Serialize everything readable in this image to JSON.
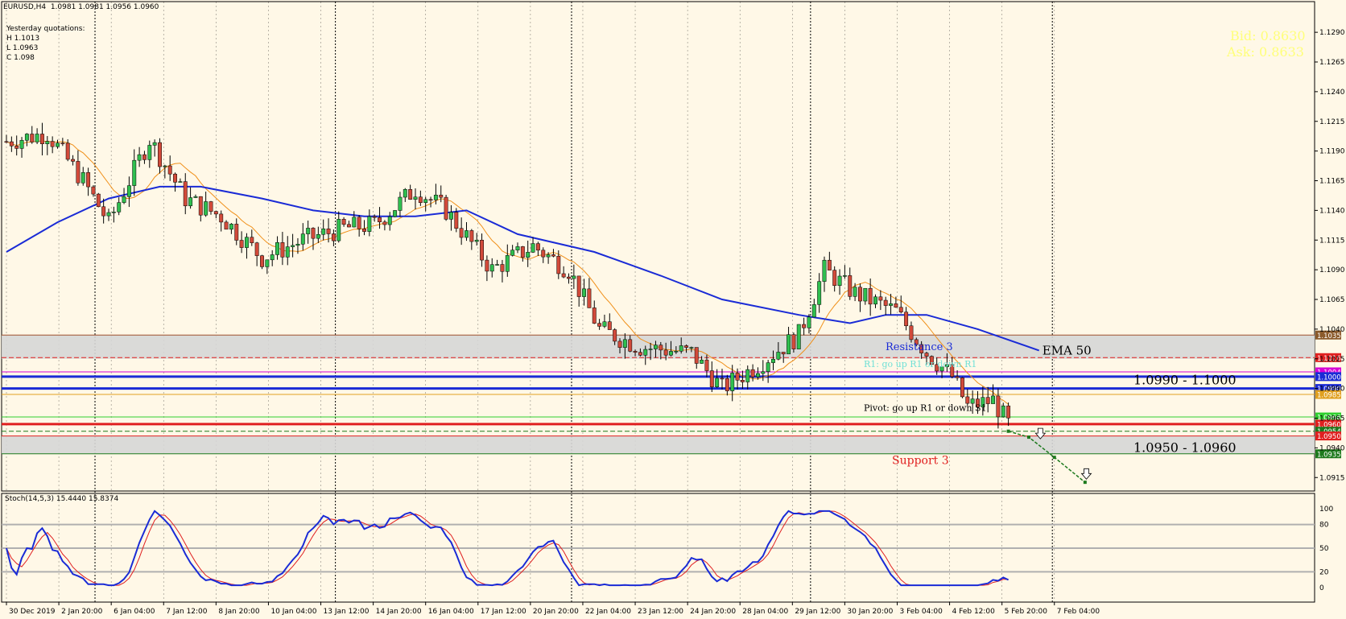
{
  "header": {
    "symbol_line": "EURUSD,H4  1.0981 1.0981 1.0956 1.0960",
    "yesterday_title": "Yesterday quotations:",
    "yesterday_high": "H 1.1013",
    "yesterday_low": "L 1.0963",
    "yesterday_close": "C 1.098"
  },
  "quotes": {
    "bid": "Bid: 0.8630",
    "ask": "Ask: 0.8633",
    "color": "#ffff7a"
  },
  "colors": {
    "background": "#fff8e7",
    "bull_candle": "#2fbf4f",
    "bear_candle": "#d24a3a",
    "ema50": "#1a2bd6",
    "fast_ma": "#f0901a",
    "stoch_main": "#1a2bd6",
    "stoch_signal": "#e02020",
    "zone_fill": "#d6d6d6",
    "projection": "#1d7a1d"
  },
  "chart_data": {
    "type": "candlestick",
    "title": "EURUSD,H4",
    "ylim": [
      1.0905,
      1.1305
    ],
    "y_ticks": [
      "1.1290",
      "1.1265",
      "1.1240",
      "1.1215",
      "1.1190",
      "1.1165",
      "1.1140",
      "1.1115",
      "1.1090",
      "1.1065",
      "1.1040",
      "1.1015",
      "1.0990",
      "1.0965",
      "1.0940",
      "1.0915"
    ],
    "x_tick_labels": [
      "30 Dec 2019",
      "2 Jan 20:00",
      "6 Jan 04:00",
      "7 Jan 12:00",
      "8 Jan 20:00",
      "10 Jan 04:00",
      "13 Jan 12:00",
      "14 Jan 20:00",
      "16 Jan 04:00",
      "17 Jan 12:00",
      "20 Jan 20:00",
      "22 Jan 04:00",
      "23 Jan 12:00",
      "24 Jan 20:00",
      "28 Jan 04:00",
      "29 Jan 12:00",
      "30 Jan 20:00",
      "3 Feb 04:00",
      "4 Feb 12:00",
      "5 Feb 20:00",
      "7 Feb 04:00"
    ],
    "close_path": [
      {
        "bar": 0,
        "close": 1.1198
      },
      {
        "bar": 8,
        "close": 1.1205
      },
      {
        "bar": 15,
        "close": 1.1165
      },
      {
        "bar": 20,
        "close": 1.113
      },
      {
        "bar": 28,
        "close": 1.12
      },
      {
        "bar": 35,
        "close": 1.115
      },
      {
        "bar": 42,
        "close": 1.1135
      },
      {
        "bar": 50,
        "close": 1.11
      },
      {
        "bar": 58,
        "close": 1.1115
      },
      {
        "bar": 66,
        "close": 1.1125
      },
      {
        "bar": 72,
        "close": 1.1128
      },
      {
        "bar": 80,
        "close": 1.1158
      },
      {
        "bar": 86,
        "close": 1.114
      },
      {
        "bar": 95,
        "close": 1.109
      },
      {
        "bar": 103,
        "close": 1.111
      },
      {
        "bar": 110,
        "close": 1.109
      },
      {
        "bar": 116,
        "close": 1.104
      },
      {
        "bar": 124,
        "close": 1.1025
      },
      {
        "bar": 134,
        "close": 1.102
      },
      {
        "bar": 140,
        "close": 1.099
      },
      {
        "bar": 147,
        "close": 1.101
      },
      {
        "bar": 155,
        "close": 1.1035
      },
      {
        "bar": 160,
        "close": 1.109
      },
      {
        "bar": 166,
        "close": 1.107
      },
      {
        "bar": 174,
        "close": 1.1055
      },
      {
        "bar": 180,
        "close": 1.102
      },
      {
        "bar": 185,
        "close": 1.1
      },
      {
        "bar": 188,
        "close": 1.0975
      },
      {
        "bar": 193,
        "close": 1.098
      },
      {
        "bar": 196,
        "close": 1.096
      }
    ],
    "ema50_path": [
      {
        "bar": 0,
        "value": 1.1105
      },
      {
        "bar": 10,
        "value": 1.113
      },
      {
        "bar": 20,
        "value": 1.115
      },
      {
        "bar": 30,
        "value": 1.116
      },
      {
        "bar": 38,
        "value": 1.116
      },
      {
        "bar": 50,
        "value": 1.115
      },
      {
        "bar": 60,
        "value": 1.114
      },
      {
        "bar": 70,
        "value": 1.1135
      },
      {
        "bar": 80,
        "value": 1.1135
      },
      {
        "bar": 90,
        "value": 1.114
      },
      {
        "bar": 100,
        "value": 1.112
      },
      {
        "bar": 115,
        "value": 1.1105
      },
      {
        "bar": 128,
        "value": 1.1085
      },
      {
        "bar": 140,
        "value": 1.1065
      },
      {
        "bar": 155,
        "value": 1.1052
      },
      {
        "bar": 165,
        "value": 1.1045
      },
      {
        "bar": 172,
        "value": 1.1052
      },
      {
        "bar": 180,
        "value": 1.1052
      },
      {
        "bar": 190,
        "value": 1.104
      },
      {
        "bar": 202,
        "value": 1.1022
      }
    ],
    "levels": [
      {
        "name": "Resistance 3",
        "value": 1.1035,
        "tag": "1.1035",
        "color": "#a0522d",
        "tag_bg": "#8b5a2b"
      },
      {
        "name": "R2",
        "value": 1.1016,
        "tag": "1.1016",
        "color": "#e02020",
        "tag_bg": "#e02020",
        "dash": true
      },
      {
        "name": "R1: go up R1 or down R1",
        "value": 1.1004,
        "tag": "1.1004",
        "color": "#d600d6",
        "tag_bg": "#d600d6"
      },
      {
        "name": "zone-top",
        "value": 1.1,
        "tag": "1.1000",
        "color": "#1a2bd6",
        "tag_bg": "#1a2bd6",
        "thick": true
      },
      {
        "name": "zone-bottom",
        "value": 1.099,
        "tag": "1.0990",
        "color": "#1a2bd6",
        "tag_bg": "#1a2bd6",
        "thick": true
      },
      {
        "name": "Pivot: go up R1 or down S1",
        "value": 1.0985,
        "tag": "1.0985",
        "color": "#e0a020",
        "tag_bg": "#e0a020"
      },
      {
        "name": "S1",
        "value": 1.0966,
        "tag": "1.0966",
        "color": "#2fcf2f",
        "tag_bg": "#2fcf2f"
      },
      {
        "name": "support-top",
        "value": 1.096,
        "tag": "1.0960",
        "color": "#e02020",
        "tag_bg": "#e02020",
        "thick": true
      },
      {
        "name": "current",
        "value": 1.0954,
        "tag": "1.0954",
        "color": "#1d7a1d",
        "tag_bg": "#1d7a1d",
        "dash": true
      },
      {
        "name": "support-bottom",
        "value": 1.095,
        "tag": "1.0950",
        "color": "#e02020",
        "tag_bg": "#e02020"
      },
      {
        "name": "Support 3",
        "value": 1.0935,
        "tag": "1.0935",
        "color": "#1d7a1d",
        "tag_bg": "#1d7a1d"
      }
    ],
    "zones": [
      {
        "from": 1.1035,
        "to": 1.1015
      },
      {
        "from": 1.095,
        "to": 1.0935
      }
    ],
    "annotations": {
      "ema": "EMA 50",
      "resistance3": "Resistance 3",
      "r1": "R1: go up R1 or down R1",
      "pivot": "Pivot: go up R1 or down S1",
      "support3": "Support 3",
      "resistance_zone": "1.0990 - 1.1000",
      "support_zone": "1.0950 - 1.0960"
    },
    "projection": [
      {
        "bar": 196,
        "value": 1.0954
      },
      {
        "bar": 200,
        "value": 1.0949
      },
      {
        "bar": 205,
        "value": 1.0932
      },
      {
        "bar": 211,
        "value": 1.0911
      }
    ],
    "stochastic": {
      "label": "Stoch(14,5,3) 15.4440 15.8374",
      "ylim": [
        0,
        100
      ],
      "levels": [
        80,
        50,
        20
      ],
      "tick_labels": [
        "100",
        "80",
        "50",
        "20",
        "0"
      ]
    }
  }
}
